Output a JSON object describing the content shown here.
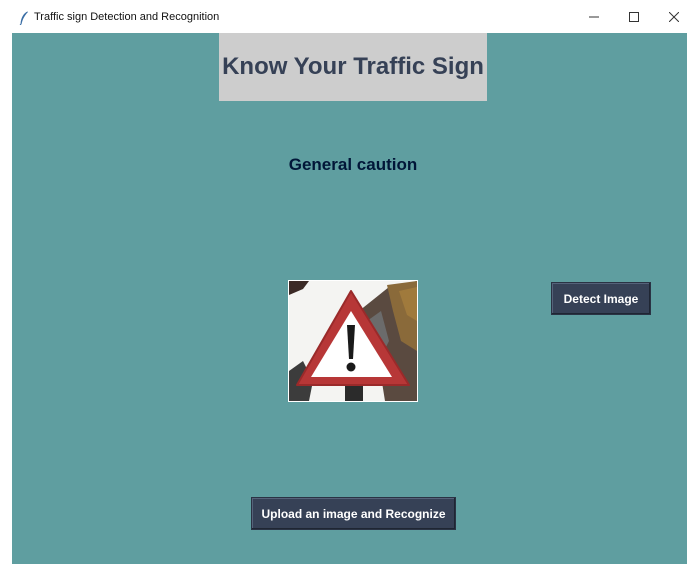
{
  "window": {
    "title": "Traffic sign Detection and Recognition",
    "icon": "feather-icon",
    "controls": {
      "minimize": "minimize-icon",
      "maximize": "maximize-icon",
      "close": "close-icon"
    }
  },
  "app": {
    "heading": "Know Your Traffic Sign",
    "result_label": "General caution",
    "image": {
      "content": "general-caution-sign-icon"
    },
    "buttons": {
      "detect": "Detect Image",
      "upload": "Upload an image and Recognize"
    }
  },
  "colors": {
    "background": "#5f9ea0",
    "heading_bg": "#cdcdcd",
    "heading_text": "#364156",
    "result_text": "#011638",
    "button_bg": "#364156",
    "button_text": "#ffffff"
  }
}
